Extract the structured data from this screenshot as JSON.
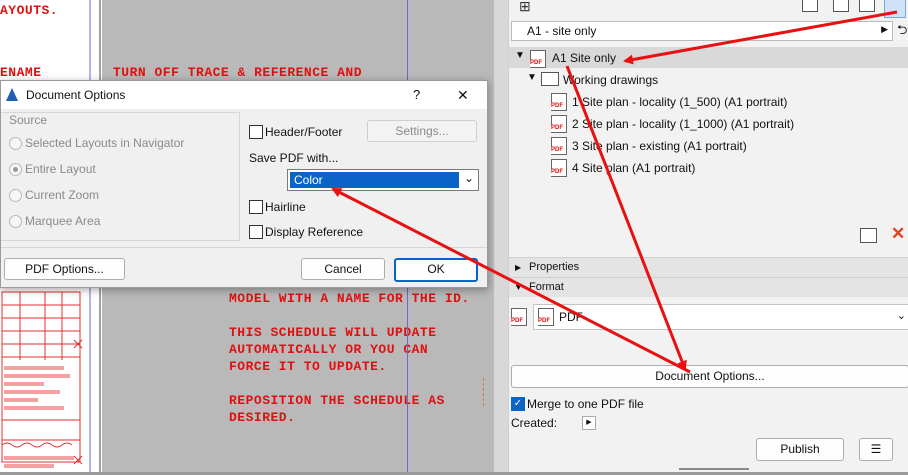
{
  "canvas": {
    "text_layouts": "AYOUTS.",
    "text_name": "ENAME",
    "text_turn_off": "TURN OFF TRACE & REFERENCE AND",
    "text_lines": [
      "MODEL WITH A NAME FOR THE ID.",
      "",
      "THIS SCHEDULE WILL UPDATE",
      "AUTOMATICALLY OR YOU CAN",
      "FORCE IT TO UPDATE.",
      "",
      "REPOSITION THE SCHEDULE AS",
      "DESIRED."
    ]
  },
  "dialog": {
    "title": "Document Options",
    "help_label": "?",
    "close_label": "✕",
    "source": {
      "label": "Source",
      "options": [
        "Selected Layouts in Navigator",
        "Entire Layout",
        "Current Zoom",
        "Marquee Area"
      ],
      "selected_index": 1
    },
    "header_footer_label": "Header/Footer",
    "settings_label": "Settings...",
    "save_pdf_label": "Save PDF with...",
    "color_value": "Color",
    "hairline_label": "Hairline",
    "display_reference_label": "Display Reference",
    "pdf_options_label": "PDF Options...",
    "cancel_label": "Cancel",
    "ok_label": "OK"
  },
  "panel": {
    "set_dropdown": "A1 - site only",
    "tree": {
      "root": "A1 Site only",
      "folder": "Working drawings",
      "items": [
        "1 Site plan - locality (1_500) (A1 portrait)",
        "2 Site plan - locality (1_1000) (A1 portrait)",
        "3 Site plan - existing (A1 portrait)",
        "4 Site plan (A1 portrait)"
      ]
    },
    "properties_label": "Properties",
    "format_label": "Format",
    "format_value": "PDF",
    "document_options_label": "Document Options...",
    "merge_label": "Merge to one PDF file",
    "created_label": "Created:",
    "publish_label": "Publish"
  },
  "colors": {
    "arrow": "#e81010",
    "selection": "#0a64c8",
    "accent": "#0a64c8"
  }
}
